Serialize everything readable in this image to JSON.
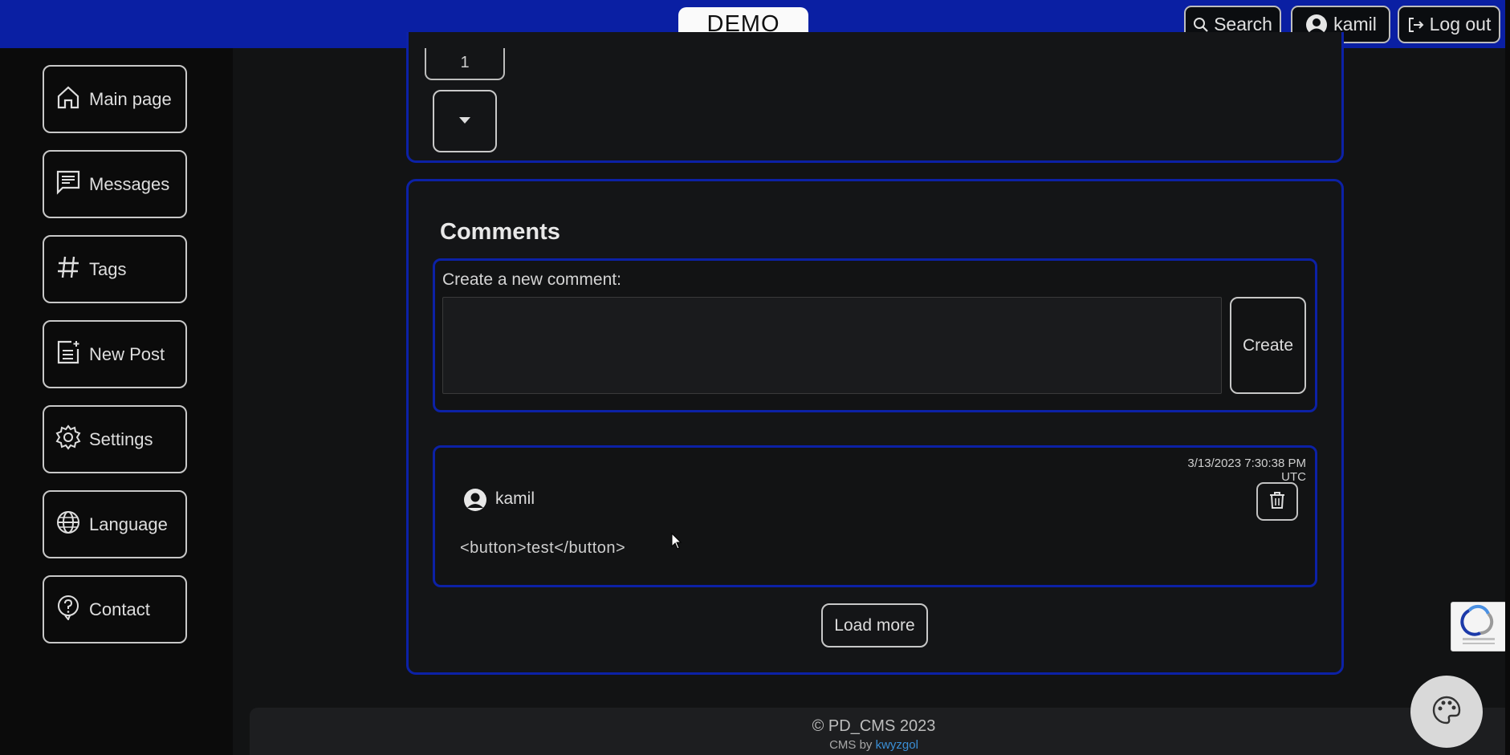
{
  "header": {
    "brand": "DEMO",
    "search_label": "Search",
    "user_label": "kamil",
    "logout_label": "Log out"
  },
  "sidebar": {
    "items": [
      {
        "label": "Main page",
        "icon": "home-icon"
      },
      {
        "label": "Messages",
        "icon": "message-icon"
      },
      {
        "label": "Tags",
        "icon": "hash-icon"
      },
      {
        "label": "New Post",
        "icon": "new-post-icon"
      },
      {
        "label": "Settings",
        "icon": "gear-icon"
      },
      {
        "label": "Language",
        "icon": "globe-icon"
      },
      {
        "label": "Contact",
        "icon": "question-icon"
      }
    ]
  },
  "post": {
    "counter_value": "1"
  },
  "comments": {
    "title": "Comments",
    "new_comment_label": "Create a new comment:",
    "textarea_value": "",
    "create_label": "Create",
    "items": [
      {
        "author": "kamil",
        "date": "3/13/2023 7:30:38 PM UTC",
        "body": "<button>test</button>"
      }
    ],
    "load_more_label": "Load more"
  },
  "footer": {
    "copyright": "© PD_CMS 2023",
    "by_prefix": "CMS by ",
    "by_link": "kwyzgol"
  },
  "colors": {
    "topbar": "#0a1fa3",
    "card_border": "#0c21a6",
    "background": "#121314",
    "link": "#3a8fd6"
  }
}
